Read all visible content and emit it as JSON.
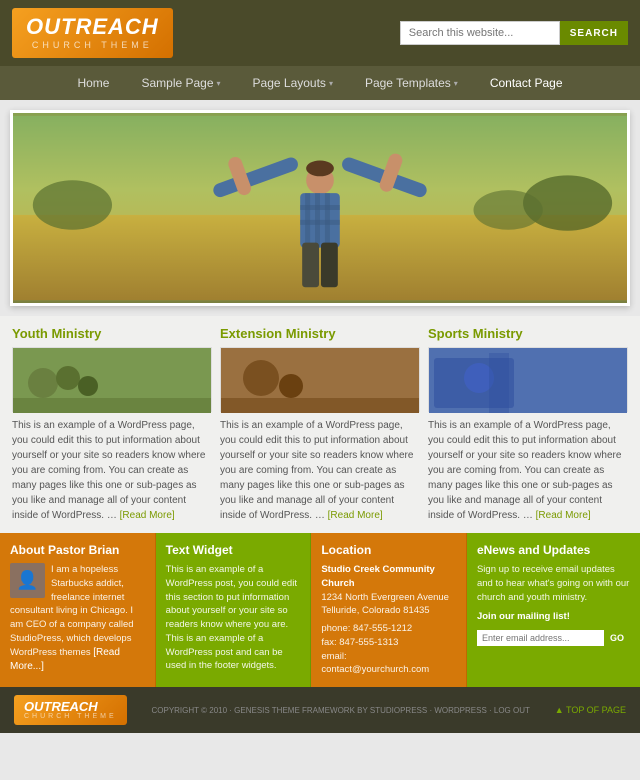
{
  "logo": {
    "title": "OUTREACH",
    "subtitle": "CHURCH THEME"
  },
  "search": {
    "placeholder": "Search this website...",
    "button_label": "SEARCH"
  },
  "nav": {
    "items": [
      {
        "label": "Home",
        "has_arrow": false
      },
      {
        "label": "Sample Page",
        "has_arrow": true
      },
      {
        "label": "Page Layouts",
        "has_arrow": true
      },
      {
        "label": "Page Templates",
        "has_arrow": true
      },
      {
        "label": "Contact Page",
        "has_arrow": false
      }
    ]
  },
  "columns": [
    {
      "title": "Youth Ministry",
      "text": "This is an example of a WordPress page, you could edit this to put information about yourself or your site so readers know where you are coming from. You can create as many pages like this one or sub-pages as you like and manage all of your content inside of WordPress. … ",
      "read_more": "[Read More]",
      "img_class": "col-img-youth"
    },
    {
      "title": "Extension Ministry",
      "text": "This is an example of a WordPress page, you could edit this to put information about yourself or your site so readers know where you are coming from. You can create as many pages like this one or sub-pages as you like and manage all of your content inside of WordPress. … ",
      "read_more": "[Read More]",
      "img_class": "col-img-ext"
    },
    {
      "title": "Sports Ministry",
      "text": "This is an example of a WordPress page, you could edit this to put information about yourself or your site so readers know where you are coming from. You can create as many pages like this one or sub-pages as you like and manage all of your content inside of WordPress. … ",
      "read_more": "[Read More]",
      "img_class": "col-img-sports"
    }
  ],
  "footer_boxes": [
    {
      "title": "About Pastor Brian",
      "text": "I am a hopeless Starbucks addict, freelance internet consultant living in Chicago. I am CEO of a company called StudioPress, which develops WordPress themes ",
      "read_more": "[Read More...]",
      "type": "pastor"
    },
    {
      "title": "Text Widget",
      "text": "This is an example of a WordPress post, you could edit this section to put information about yourself or your site so readers know where you are. This is an example of a WordPress post and can be used in the footer widgets.",
      "type": "text",
      "color": "green"
    },
    {
      "title": "Location",
      "church_name": "Studio Creek Community Church",
      "address": "1234 North Evergreen Avenue",
      "city": "Telluride, Colorado 81435",
      "phone": "phone: 847-555-1212",
      "fax": "fax: 847-555-1313",
      "email": "email: contact@yourchurch.com",
      "type": "location"
    },
    {
      "title": "eNews and Updates",
      "text": "Sign up to receive email updates and to hear what's going on with our church and youth ministry.",
      "join_label": "Join our mailing list!",
      "email_placeholder": "Enter email address...",
      "go_label": "GO",
      "type": "enews"
    }
  ],
  "footer": {
    "logo_title": "OUTREACH",
    "logo_sub": "CHURCH THEME",
    "copyright": "COPYRIGHT © 2010 · GENESIS THEME FRAMEWORK BY STUDIOPRESS · WORDPRESS · LOG OUT",
    "top_label": "▲ TOP OF PAGE"
  }
}
